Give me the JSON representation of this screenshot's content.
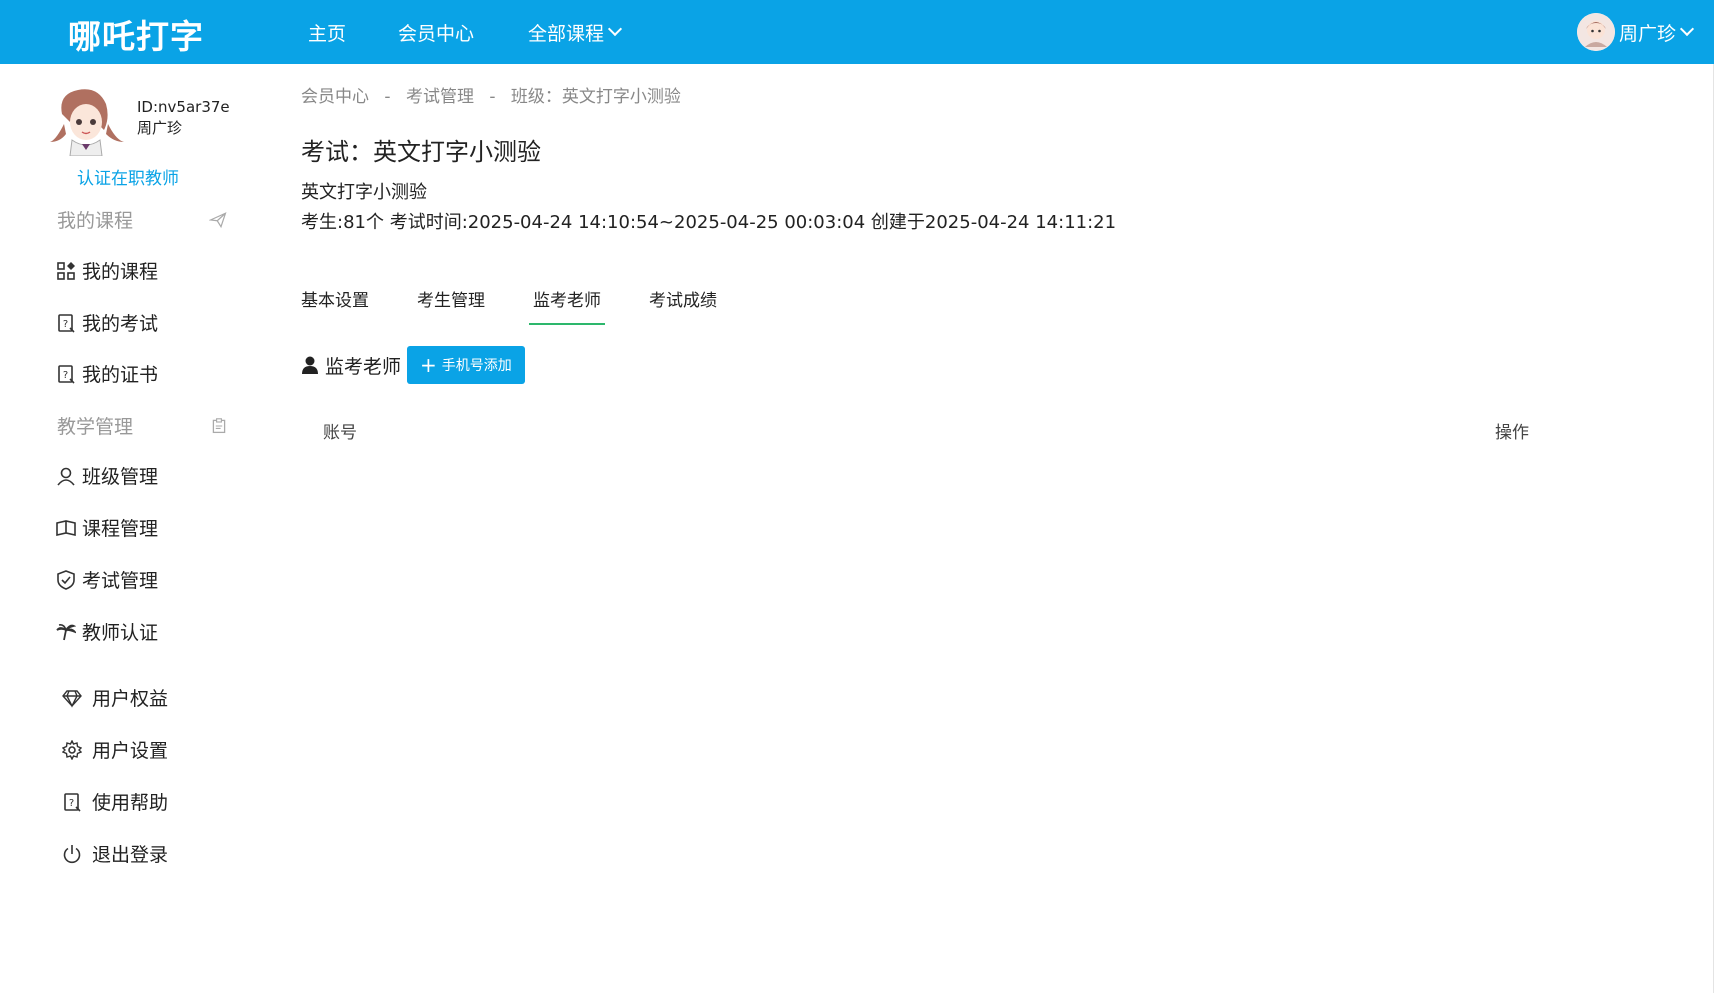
{
  "header": {
    "logo": "哪吒打字",
    "nav": [
      "主页",
      "会员中心",
      "全部课程"
    ],
    "user_name": "周广珍"
  },
  "sidebar": {
    "user_id": "ID:nv5ar37e",
    "user_name": "周广珍",
    "certify_link": "认证在职教师",
    "section_courses": "我的课程",
    "course_items": [
      "我的课程",
      "我的考试",
      "我的证书"
    ],
    "section_teaching": "教学管理",
    "teaching_items": [
      "班级管理",
      "课程管理",
      "考试管理",
      "教师认证"
    ],
    "bottom_items": [
      "用户权益",
      "用户设置",
      "使用帮助",
      "退出登录"
    ]
  },
  "breadcrumb": [
    "会员中心",
    "-",
    "考试管理",
    "-",
    "班级：英文打字小测验"
  ],
  "exam": {
    "title": "考试：英文打字小测验",
    "name": "英文打字小测验",
    "meta": "考生:81个 考试时间:2025-04-24 14:10:54~2025-04-25 00:03:04 创建于2025-04-24 14:11:21"
  },
  "tabs": [
    "基本设置",
    "考生管理",
    "监考老师",
    "考试成绩"
  ],
  "proctor": {
    "heading": "监考老师",
    "add_button": "手机号添加"
  },
  "table": {
    "columns": [
      "账号",
      "操作"
    ]
  },
  "colors": {
    "primary": "#0aa3e6",
    "active_tab": "#2db76c"
  }
}
